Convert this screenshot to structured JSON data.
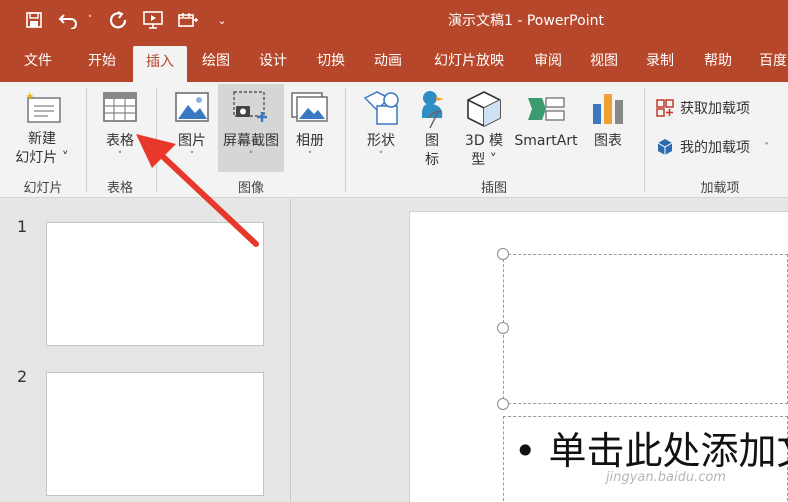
{
  "window": {
    "title": "演示文稿1  -  PowerPoint"
  },
  "colors": {
    "accent": "#b7472a",
    "ribbon_bg": "#f3f3f3",
    "annotation_arrow": "#e8382c"
  },
  "tabs": [
    "文件",
    "开始",
    "插入",
    "绘图",
    "设计",
    "切换",
    "动画",
    "幻灯片放映",
    "审阅",
    "视图",
    "录制",
    "帮助",
    "百度"
  ],
  "active_tab": "插入",
  "ribbon": {
    "new_slide": {
      "label1": "新建",
      "label2": "幻灯片 ˅"
    },
    "table": {
      "label": "表格"
    },
    "picture": {
      "label": "图片"
    },
    "screenshot": {
      "label": "屏幕截图"
    },
    "album": {
      "label": "相册"
    },
    "shapes": {
      "label": "形状"
    },
    "icons": {
      "label1": "图",
      "label2": "标"
    },
    "model3d": {
      "label1": "3D 模",
      "label2": "型 ˅"
    },
    "smartart": {
      "label": "SmartArt"
    },
    "chart": {
      "label": "图表"
    },
    "get_addins": {
      "label": "获取加载项"
    },
    "my_addins": {
      "label": "我的加载项"
    },
    "groups": {
      "slides": "幻灯片",
      "tables": "表格",
      "images": "图像",
      "illustrations": "插图",
      "addins": "加载项"
    }
  },
  "slides": {
    "numbers": [
      "1",
      "2"
    ]
  },
  "editor": {
    "body_placeholder": "• 单击此处添加文",
    "watermark": "jingyan.baidu.com"
  }
}
